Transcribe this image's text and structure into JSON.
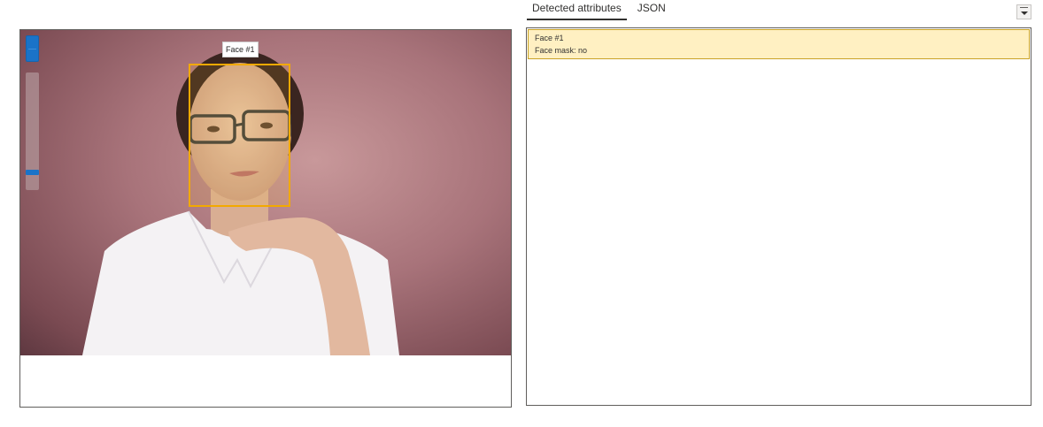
{
  "tabs": [
    {
      "label": "Detected attributes",
      "active": true
    },
    {
      "label": "JSON",
      "active": false
    }
  ],
  "image": {
    "face_label": "Face #1",
    "zoom_level": 0.1,
    "box_color": "#f2a900"
  },
  "results": [
    {
      "title": "Face #1",
      "attribute": "Face mask: no"
    }
  ],
  "colors": {
    "accent": "#1a73c8",
    "highlight_bg": "#fff0c2",
    "highlight_border": "#c9a227"
  },
  "icons": {
    "collapse": "chevron-down-icon"
  }
}
